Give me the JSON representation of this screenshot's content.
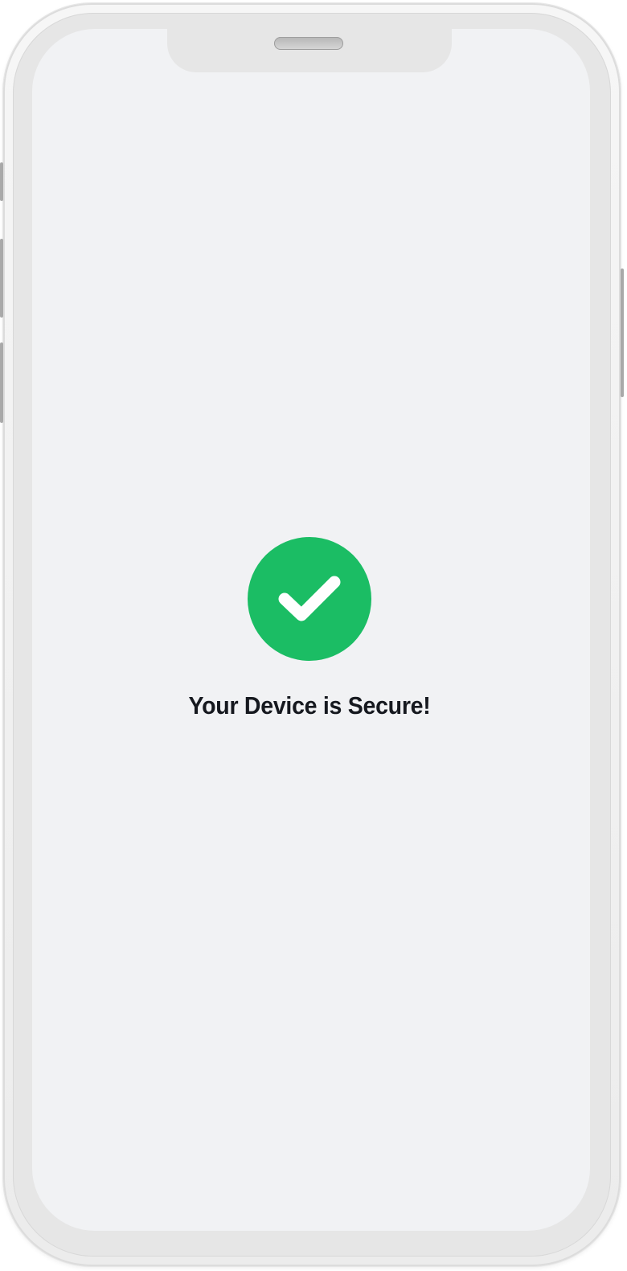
{
  "screen": {
    "status_icon": "check-circle-icon",
    "status_color": "#1bbd64",
    "title": "Your Device is Secure!"
  },
  "device": {
    "frame_color": "#f1f1f1",
    "screen_color": "#f1f2f4"
  }
}
